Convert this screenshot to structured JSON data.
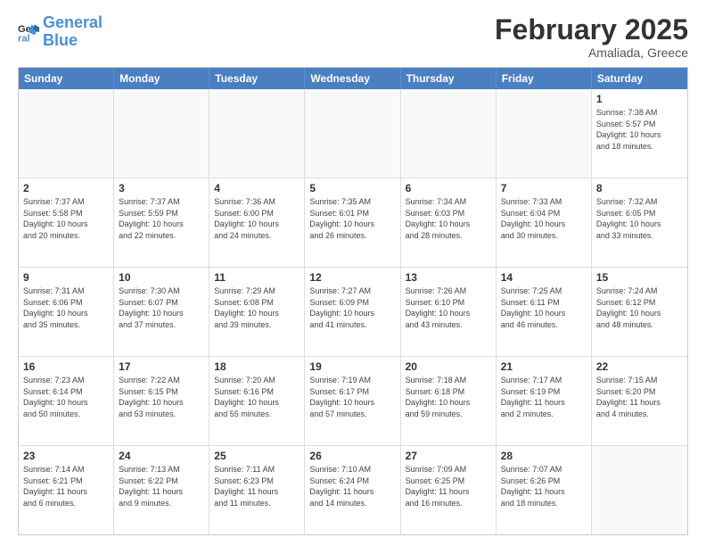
{
  "logo": {
    "line1": "General",
    "line2": "Blue"
  },
  "title": "February 2025",
  "location": "Amaliada, Greece",
  "weekdays": [
    "Sunday",
    "Monday",
    "Tuesday",
    "Wednesday",
    "Thursday",
    "Friday",
    "Saturday"
  ],
  "rows": [
    [
      {
        "day": "",
        "info": ""
      },
      {
        "day": "",
        "info": ""
      },
      {
        "day": "",
        "info": ""
      },
      {
        "day": "",
        "info": ""
      },
      {
        "day": "",
        "info": ""
      },
      {
        "day": "",
        "info": ""
      },
      {
        "day": "1",
        "info": "Sunrise: 7:38 AM\nSunset: 5:57 PM\nDaylight: 10 hours\nand 18 minutes."
      }
    ],
    [
      {
        "day": "2",
        "info": "Sunrise: 7:37 AM\nSunset: 5:58 PM\nDaylight: 10 hours\nand 20 minutes."
      },
      {
        "day": "3",
        "info": "Sunrise: 7:37 AM\nSunset: 5:59 PM\nDaylight: 10 hours\nand 22 minutes."
      },
      {
        "day": "4",
        "info": "Sunrise: 7:36 AM\nSunset: 6:00 PM\nDaylight: 10 hours\nand 24 minutes."
      },
      {
        "day": "5",
        "info": "Sunrise: 7:35 AM\nSunset: 6:01 PM\nDaylight: 10 hours\nand 26 minutes."
      },
      {
        "day": "6",
        "info": "Sunrise: 7:34 AM\nSunset: 6:03 PM\nDaylight: 10 hours\nand 28 minutes."
      },
      {
        "day": "7",
        "info": "Sunrise: 7:33 AM\nSunset: 6:04 PM\nDaylight: 10 hours\nand 30 minutes."
      },
      {
        "day": "8",
        "info": "Sunrise: 7:32 AM\nSunset: 6:05 PM\nDaylight: 10 hours\nand 33 minutes."
      }
    ],
    [
      {
        "day": "9",
        "info": "Sunrise: 7:31 AM\nSunset: 6:06 PM\nDaylight: 10 hours\nand 35 minutes."
      },
      {
        "day": "10",
        "info": "Sunrise: 7:30 AM\nSunset: 6:07 PM\nDaylight: 10 hours\nand 37 minutes."
      },
      {
        "day": "11",
        "info": "Sunrise: 7:29 AM\nSunset: 6:08 PM\nDaylight: 10 hours\nand 39 minutes."
      },
      {
        "day": "12",
        "info": "Sunrise: 7:27 AM\nSunset: 6:09 PM\nDaylight: 10 hours\nand 41 minutes."
      },
      {
        "day": "13",
        "info": "Sunrise: 7:26 AM\nSunset: 6:10 PM\nDaylight: 10 hours\nand 43 minutes."
      },
      {
        "day": "14",
        "info": "Sunrise: 7:25 AM\nSunset: 6:11 PM\nDaylight: 10 hours\nand 46 minutes."
      },
      {
        "day": "15",
        "info": "Sunrise: 7:24 AM\nSunset: 6:12 PM\nDaylight: 10 hours\nand 48 minutes."
      }
    ],
    [
      {
        "day": "16",
        "info": "Sunrise: 7:23 AM\nSunset: 6:14 PM\nDaylight: 10 hours\nand 50 minutes."
      },
      {
        "day": "17",
        "info": "Sunrise: 7:22 AM\nSunset: 6:15 PM\nDaylight: 10 hours\nand 53 minutes."
      },
      {
        "day": "18",
        "info": "Sunrise: 7:20 AM\nSunset: 6:16 PM\nDaylight: 10 hours\nand 55 minutes."
      },
      {
        "day": "19",
        "info": "Sunrise: 7:19 AM\nSunset: 6:17 PM\nDaylight: 10 hours\nand 57 minutes."
      },
      {
        "day": "20",
        "info": "Sunrise: 7:18 AM\nSunset: 6:18 PM\nDaylight: 10 hours\nand 59 minutes."
      },
      {
        "day": "21",
        "info": "Sunrise: 7:17 AM\nSunset: 6:19 PM\nDaylight: 11 hours\nand 2 minutes."
      },
      {
        "day": "22",
        "info": "Sunrise: 7:15 AM\nSunset: 6:20 PM\nDaylight: 11 hours\nand 4 minutes."
      }
    ],
    [
      {
        "day": "23",
        "info": "Sunrise: 7:14 AM\nSunset: 6:21 PM\nDaylight: 11 hours\nand 6 minutes."
      },
      {
        "day": "24",
        "info": "Sunrise: 7:13 AM\nSunset: 6:22 PM\nDaylight: 11 hours\nand 9 minutes."
      },
      {
        "day": "25",
        "info": "Sunrise: 7:11 AM\nSunset: 6:23 PM\nDaylight: 11 hours\nand 11 minutes."
      },
      {
        "day": "26",
        "info": "Sunrise: 7:10 AM\nSunset: 6:24 PM\nDaylight: 11 hours\nand 14 minutes."
      },
      {
        "day": "27",
        "info": "Sunrise: 7:09 AM\nSunset: 6:25 PM\nDaylight: 11 hours\nand 16 minutes."
      },
      {
        "day": "28",
        "info": "Sunrise: 7:07 AM\nSunset: 6:26 PM\nDaylight: 11 hours\nand 18 minutes."
      },
      {
        "day": "",
        "info": ""
      }
    ]
  ]
}
